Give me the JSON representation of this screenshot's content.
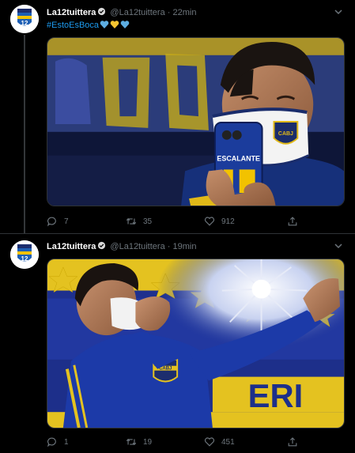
{
  "tweets": [
    {
      "display_name": "La12tuittera",
      "handle": "@La12tuittera",
      "separator": "·",
      "time": "22min",
      "hashtag": "#EstoEsBoca",
      "emojis": [
        "blue-heart",
        "yellow-heart",
        "blue-heart"
      ],
      "media_text": {
        "mask": "CABJ",
        "phone": "ESCALANTE"
      },
      "replies": "7",
      "retweets": "35",
      "likes": "912"
    },
    {
      "display_name": "La12tuittera",
      "handle": "@La12tuittera",
      "separator": "·",
      "time": "19min",
      "media_text": {
        "banner": "ERI",
        "crest": "CABJ"
      },
      "replies": "1",
      "retweets": "19",
      "likes": "451"
    }
  ],
  "avatar_text": "12",
  "colors": {
    "background": "#000000",
    "accent_blue": "#1d9bf0",
    "muted": "#6e767d",
    "boca_blue": "#1c2d6e",
    "boca_yellow": "#f2c200"
  }
}
